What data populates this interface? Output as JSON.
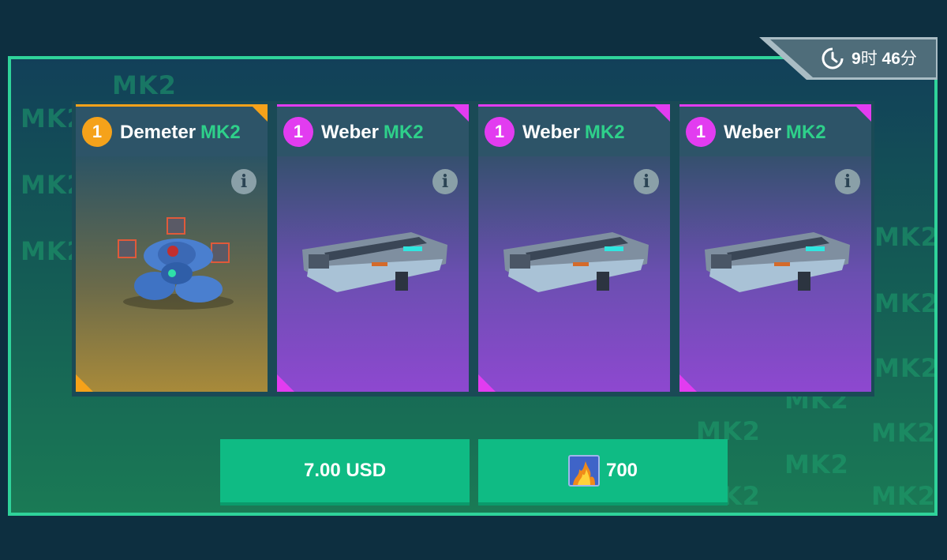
{
  "timer": {
    "hours": "9",
    "hours_unit": "时",
    "minutes": "46",
    "minutes_unit": "分",
    "icon": "clock-icon"
  },
  "watermark_text": "MK2",
  "cards": [
    {
      "count": "1",
      "name": "Demeter",
      "tier": "MK2",
      "rarity": "rare",
      "item_icon": "demeter-robot",
      "info_label": "i"
    },
    {
      "count": "1",
      "name": "Weber",
      "tier": "MK2",
      "rarity": "epic",
      "item_icon": "weber-weapon",
      "info_label": "i"
    },
    {
      "count": "1",
      "name": "Weber",
      "tier": "MK2",
      "rarity": "epic",
      "item_icon": "weber-weapon",
      "info_label": "i"
    },
    {
      "count": "1",
      "name": "Weber",
      "tier": "MK2",
      "rarity": "epic",
      "item_icon": "weber-weapon",
      "info_label": "i"
    }
  ],
  "purchase": {
    "real_money": {
      "label": "7.00 USD"
    },
    "in_game": {
      "amount": "700",
      "currency_icon": "premium-currency-icon"
    }
  },
  "colors": {
    "accent_green": "#2fd39a",
    "button_green": "#0fbb84",
    "rare_orange": "#f5a21a",
    "epic_magenta": "#e23cf0",
    "tier_text_green": "#2ed08a"
  }
}
